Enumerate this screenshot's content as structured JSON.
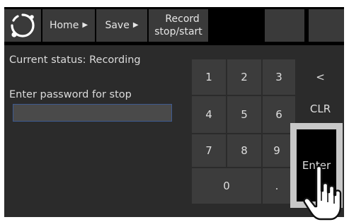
{
  "toolbar": {
    "logo_icon": "ring-logo-icon",
    "home_label": "Home",
    "save_label": "Save",
    "record_label_line1": "Record",
    "record_label_line2": "stop/start",
    "arrow_icon": "triangle-right-icon"
  },
  "main": {
    "status_text": "Current status: Recording",
    "password_label": "Enter password for stop",
    "password_value": ""
  },
  "keypad": {
    "k1": "1",
    "k2": "2",
    "k3": "3",
    "back": "<",
    "k4": "4",
    "k5": "5",
    "k6": "6",
    "clr": "CLR",
    "k7": "7",
    "k8": "8",
    "k9": "9",
    "k0": ".",
    "k0_label": "0",
    "dot": ".",
    "enter": "Enter"
  },
  "cursor": {
    "icon": "pointing-hand-icon"
  },
  "colors": {
    "screen_bg": "#000000",
    "panel_bg": "#2b2b2b",
    "button_bg": "#3a3a3a",
    "field_border": "#3d5a90",
    "highlight_frame": "#c8c8c8"
  }
}
